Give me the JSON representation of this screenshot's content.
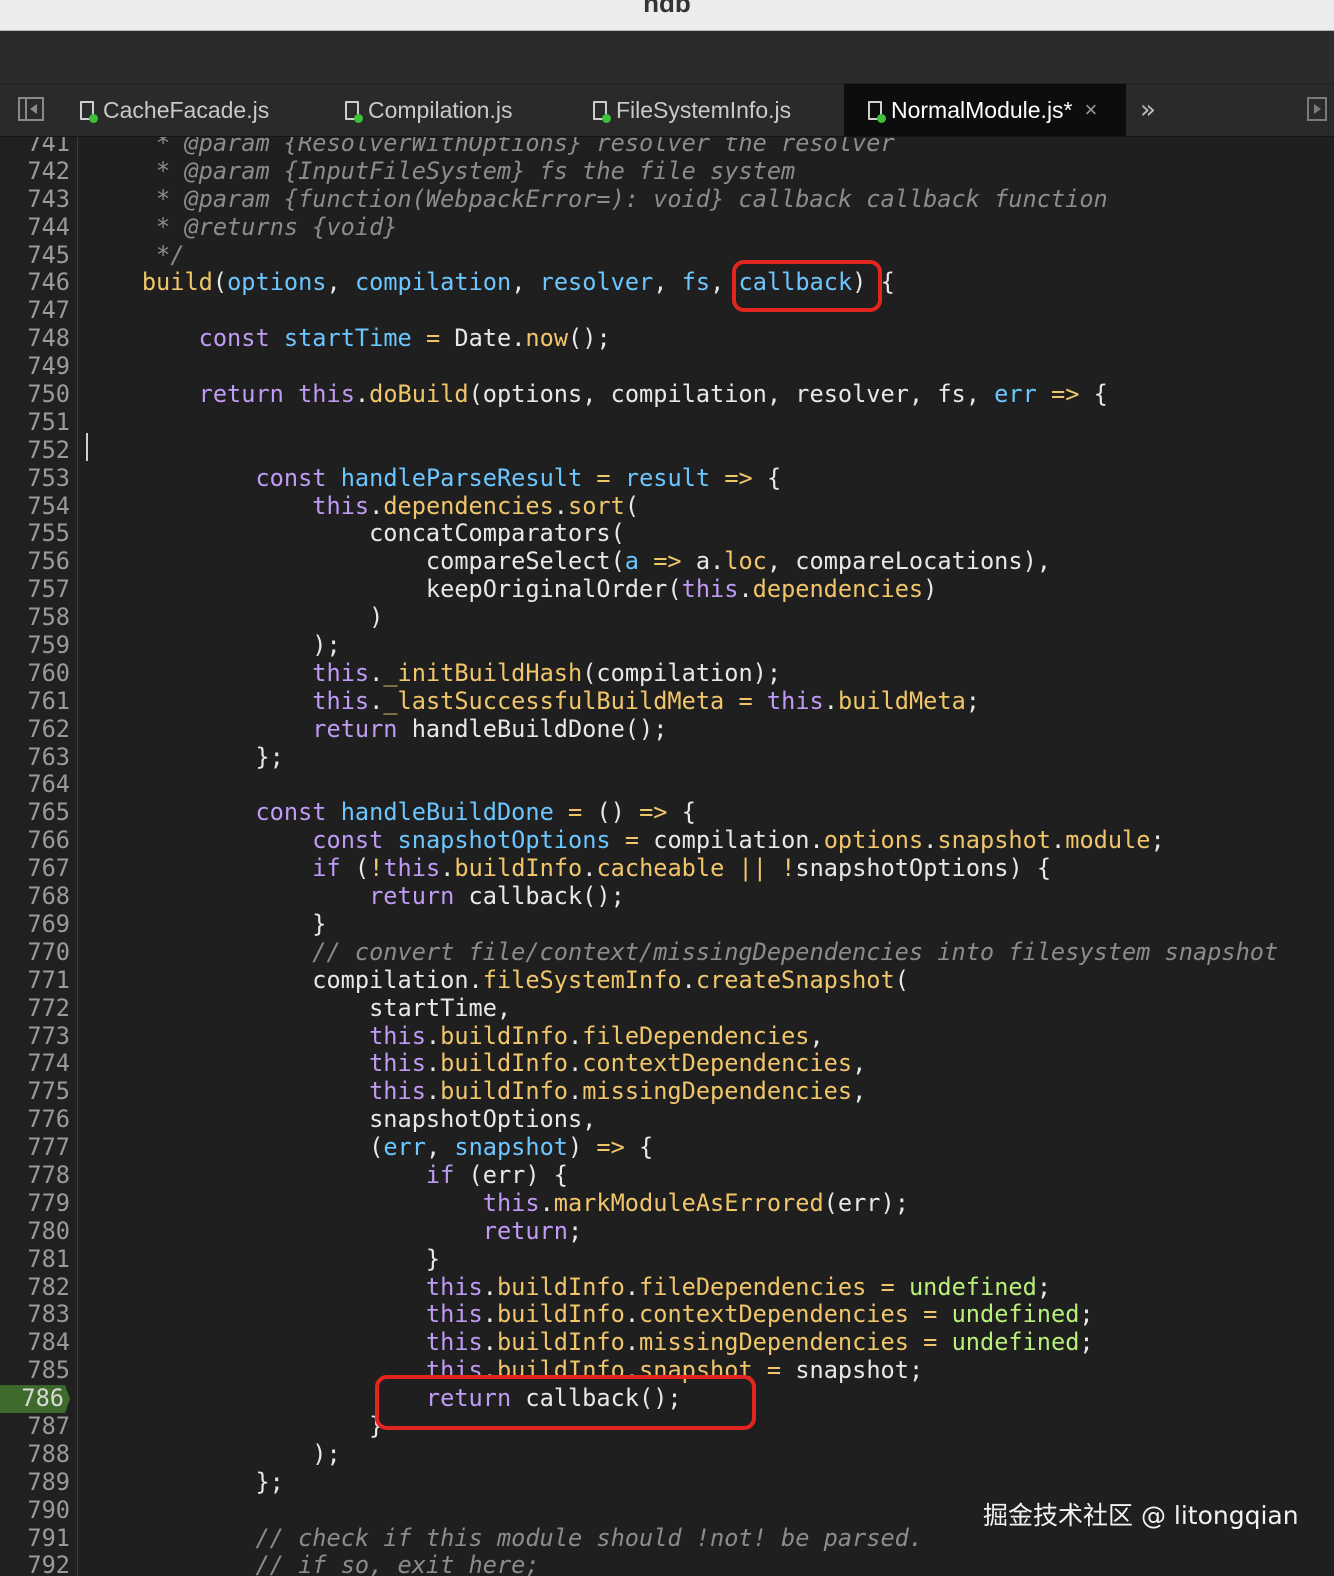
{
  "window": {
    "title": "ndb"
  },
  "tabs": [
    {
      "label": "CacheFacade.js",
      "active": false
    },
    {
      "label": "Compilation.js",
      "active": false
    },
    {
      "label": "FileSystemInfo.js",
      "active": false
    },
    {
      "label": "NormalModule.js*",
      "active": true
    }
  ],
  "tab_close_glyph": "×",
  "overflow_glyph": "»",
  "breakpoint_line": "786",
  "colors": {
    "comment": "#8c8c8c",
    "keyword": "#c09bf5",
    "identifier": "#6cc6ff",
    "function": "#f1c66a",
    "constant": "#b8f07a",
    "annotation": "#e3251f",
    "breakpoint": "#3e6b2b"
  },
  "code": [
    {
      "n": "741",
      "tokens": [
        [
          "cm",
          "     * @param {ResolverWithOptions} resolver the resolver"
        ]
      ]
    },
    {
      "n": "742",
      "tokens": [
        [
          "cm",
          "     * @param {InputFileSystem} fs the file system"
        ]
      ]
    },
    {
      "n": "743",
      "tokens": [
        [
          "cm",
          "     * @param {function(WebpackError=): void} callback callback function"
        ]
      ]
    },
    {
      "n": "744",
      "tokens": [
        [
          "cm",
          "     * @returns {void}"
        ]
      ]
    },
    {
      "n": "745",
      "tokens": [
        [
          "cm",
          "     */"
        ]
      ]
    },
    {
      "n": "746",
      "tokens": [
        [
          "pl",
          "    "
        ],
        [
          "fn",
          "build"
        ],
        [
          "pl",
          "("
        ],
        [
          "id",
          "options"
        ],
        [
          "pl",
          ", "
        ],
        [
          "id",
          "compilation"
        ],
        [
          "pl",
          ", "
        ],
        [
          "id",
          "resolver"
        ],
        [
          "pl",
          ", "
        ],
        [
          "id",
          "fs"
        ],
        [
          "pl",
          ", "
        ],
        [
          "id",
          "callback"
        ],
        [
          "pl",
          ") {"
        ]
      ]
    },
    {
      "n": "747",
      "tokens": []
    },
    {
      "n": "748",
      "tokens": [
        [
          "pl",
          "        "
        ],
        [
          "kw",
          "const"
        ],
        [
          "pl",
          " "
        ],
        [
          "id",
          "startTime"
        ],
        [
          "pl",
          " "
        ],
        [
          "fn",
          "="
        ],
        [
          "pl",
          " Date."
        ],
        [
          "fn",
          "now"
        ],
        [
          "pl",
          "();"
        ]
      ]
    },
    {
      "n": "749",
      "tokens": []
    },
    {
      "n": "750",
      "tokens": [
        [
          "pl",
          "        "
        ],
        [
          "kw",
          "return"
        ],
        [
          "pl",
          " "
        ],
        [
          "kw",
          "this"
        ],
        [
          "pl",
          "."
        ],
        [
          "fn",
          "doBuild"
        ],
        [
          "pl",
          "(options, compilation, resolver, fs, "
        ],
        [
          "id",
          "err"
        ],
        [
          "pl",
          " "
        ],
        [
          "fn",
          "=>"
        ],
        [
          "pl",
          " {"
        ]
      ]
    },
    {
      "n": "751",
      "tokens": []
    },
    {
      "n": "752",
      "tokens": []
    },
    {
      "n": "753",
      "tokens": [
        [
          "pl",
          "            "
        ],
        [
          "kw",
          "const"
        ],
        [
          "pl",
          " "
        ],
        [
          "id",
          "handleParseResult"
        ],
        [
          "pl",
          " "
        ],
        [
          "fn",
          "="
        ],
        [
          "pl",
          " "
        ],
        [
          "id",
          "result"
        ],
        [
          "pl",
          " "
        ],
        [
          "fn",
          "=>"
        ],
        [
          "pl",
          " {"
        ]
      ]
    },
    {
      "n": "754",
      "tokens": [
        [
          "pl",
          "                "
        ],
        [
          "kw",
          "this"
        ],
        [
          "pl",
          "."
        ],
        [
          "fn",
          "dependencies"
        ],
        [
          "pl",
          "."
        ],
        [
          "fn",
          "sort"
        ],
        [
          "pl",
          "("
        ]
      ]
    },
    {
      "n": "755",
      "tokens": [
        [
          "pl",
          "                    concatComparators("
        ]
      ]
    },
    {
      "n": "756",
      "tokens": [
        [
          "pl",
          "                        compareSelect("
        ],
        [
          "id",
          "a"
        ],
        [
          "pl",
          " "
        ],
        [
          "fn",
          "=>"
        ],
        [
          "pl",
          " a."
        ],
        [
          "fn",
          "loc"
        ],
        [
          "pl",
          ", compareLocations),"
        ]
      ]
    },
    {
      "n": "757",
      "tokens": [
        [
          "pl",
          "                        keepOriginalOrder("
        ],
        [
          "kw",
          "this"
        ],
        [
          "pl",
          "."
        ],
        [
          "fn",
          "dependencies"
        ],
        [
          "pl",
          ")"
        ]
      ]
    },
    {
      "n": "758",
      "tokens": [
        [
          "pl",
          "                    )"
        ]
      ]
    },
    {
      "n": "759",
      "tokens": [
        [
          "pl",
          "                );"
        ]
      ]
    },
    {
      "n": "760",
      "tokens": [
        [
          "pl",
          "                "
        ],
        [
          "kw",
          "this"
        ],
        [
          "pl",
          "."
        ],
        [
          "fn",
          "_initBuildHash"
        ],
        [
          "pl",
          "(compilation);"
        ]
      ]
    },
    {
      "n": "761",
      "tokens": [
        [
          "pl",
          "                "
        ],
        [
          "kw",
          "this"
        ],
        [
          "pl",
          "."
        ],
        [
          "fn",
          "_lastSuccessfulBuildMeta"
        ],
        [
          "pl",
          " "
        ],
        [
          "fn",
          "="
        ],
        [
          "pl",
          " "
        ],
        [
          "kw",
          "this"
        ],
        [
          "pl",
          "."
        ],
        [
          "fn",
          "buildMeta"
        ],
        [
          "pl",
          ";"
        ]
      ]
    },
    {
      "n": "762",
      "tokens": [
        [
          "pl",
          "                "
        ],
        [
          "kw",
          "return"
        ],
        [
          "pl",
          " handleBuildDone();"
        ]
      ]
    },
    {
      "n": "763",
      "tokens": [
        [
          "pl",
          "            };"
        ]
      ]
    },
    {
      "n": "764",
      "tokens": []
    },
    {
      "n": "765",
      "tokens": [
        [
          "pl",
          "            "
        ],
        [
          "kw",
          "const"
        ],
        [
          "pl",
          " "
        ],
        [
          "id",
          "handleBuildDone"
        ],
        [
          "pl",
          " "
        ],
        [
          "fn",
          "="
        ],
        [
          "pl",
          " () "
        ],
        [
          "fn",
          "=>"
        ],
        [
          "pl",
          " {"
        ]
      ]
    },
    {
      "n": "766",
      "tokens": [
        [
          "pl",
          "                "
        ],
        [
          "kw",
          "const"
        ],
        [
          "pl",
          " "
        ],
        [
          "id",
          "snapshotOptions"
        ],
        [
          "pl",
          " "
        ],
        [
          "fn",
          "="
        ],
        [
          "pl",
          " compilation."
        ],
        [
          "fn",
          "options"
        ],
        [
          "pl",
          "."
        ],
        [
          "fn",
          "snapshot"
        ],
        [
          "pl",
          "."
        ],
        [
          "fn",
          "module"
        ],
        [
          "pl",
          ";"
        ]
      ]
    },
    {
      "n": "767",
      "tokens": [
        [
          "pl",
          "                "
        ],
        [
          "kw",
          "if"
        ],
        [
          "pl",
          " ("
        ],
        [
          "fn",
          "!"
        ],
        [
          "kw",
          "this"
        ],
        [
          "pl",
          "."
        ],
        [
          "fn",
          "buildInfo"
        ],
        [
          "pl",
          "."
        ],
        [
          "fn",
          "cacheable"
        ],
        [
          "pl",
          " "
        ],
        [
          "fn",
          "||"
        ],
        [
          "pl",
          " "
        ],
        [
          "fn",
          "!"
        ],
        [
          "pl",
          "snapshotOptions) {"
        ]
      ]
    },
    {
      "n": "768",
      "tokens": [
        [
          "pl",
          "                    "
        ],
        [
          "kw",
          "return"
        ],
        [
          "pl",
          " callback();"
        ]
      ]
    },
    {
      "n": "769",
      "tokens": [
        [
          "pl",
          "                }"
        ]
      ]
    },
    {
      "n": "770",
      "tokens": [
        [
          "pl",
          "                "
        ],
        [
          "cm",
          "// convert file/context/missingDependencies into filesystem snapshot"
        ]
      ]
    },
    {
      "n": "771",
      "tokens": [
        [
          "pl",
          "                compilation."
        ],
        [
          "fn",
          "fileSystemInfo"
        ],
        [
          "pl",
          "."
        ],
        [
          "fn",
          "createSnapshot"
        ],
        [
          "pl",
          "("
        ]
      ]
    },
    {
      "n": "772",
      "tokens": [
        [
          "pl",
          "                    startTime,"
        ]
      ]
    },
    {
      "n": "773",
      "tokens": [
        [
          "pl",
          "                    "
        ],
        [
          "kw",
          "this"
        ],
        [
          "pl",
          "."
        ],
        [
          "fn",
          "buildInfo"
        ],
        [
          "pl",
          "."
        ],
        [
          "fn",
          "fileDependencies"
        ],
        [
          "pl",
          ","
        ]
      ]
    },
    {
      "n": "774",
      "tokens": [
        [
          "pl",
          "                    "
        ],
        [
          "kw",
          "this"
        ],
        [
          "pl",
          "."
        ],
        [
          "fn",
          "buildInfo"
        ],
        [
          "pl",
          "."
        ],
        [
          "fn",
          "contextDependencies"
        ],
        [
          "pl",
          ","
        ]
      ]
    },
    {
      "n": "775",
      "tokens": [
        [
          "pl",
          "                    "
        ],
        [
          "kw",
          "this"
        ],
        [
          "pl",
          "."
        ],
        [
          "fn",
          "buildInfo"
        ],
        [
          "pl",
          "."
        ],
        [
          "fn",
          "missingDependencies"
        ],
        [
          "pl",
          ","
        ]
      ]
    },
    {
      "n": "776",
      "tokens": [
        [
          "pl",
          "                    snapshotOptions,"
        ]
      ]
    },
    {
      "n": "777",
      "tokens": [
        [
          "pl",
          "                    ("
        ],
        [
          "id",
          "err"
        ],
        [
          "pl",
          ", "
        ],
        [
          "id",
          "snapshot"
        ],
        [
          "pl",
          ") "
        ],
        [
          "fn",
          "=>"
        ],
        [
          "pl",
          " {"
        ]
      ]
    },
    {
      "n": "778",
      "tokens": [
        [
          "pl",
          "                        "
        ],
        [
          "kw",
          "if"
        ],
        [
          "pl",
          " (err) {"
        ]
      ]
    },
    {
      "n": "779",
      "tokens": [
        [
          "pl",
          "                            "
        ],
        [
          "kw",
          "this"
        ],
        [
          "pl",
          "."
        ],
        [
          "fn",
          "markModuleAsErrored"
        ],
        [
          "pl",
          "(err);"
        ]
      ]
    },
    {
      "n": "780",
      "tokens": [
        [
          "pl",
          "                            "
        ],
        [
          "kw",
          "return"
        ],
        [
          "pl",
          ";"
        ]
      ]
    },
    {
      "n": "781",
      "tokens": [
        [
          "pl",
          "                        }"
        ]
      ]
    },
    {
      "n": "782",
      "tokens": [
        [
          "pl",
          "                        "
        ],
        [
          "kw",
          "this"
        ],
        [
          "pl",
          "."
        ],
        [
          "fn",
          "buildInfo"
        ],
        [
          "pl",
          "."
        ],
        [
          "fn",
          "fileDependencies"
        ],
        [
          "pl",
          " "
        ],
        [
          "fn",
          "="
        ],
        [
          "pl",
          " "
        ],
        [
          "ct",
          "undefined"
        ],
        [
          "pl",
          ";"
        ]
      ]
    },
    {
      "n": "783",
      "tokens": [
        [
          "pl",
          "                        "
        ],
        [
          "kw",
          "this"
        ],
        [
          "pl",
          "."
        ],
        [
          "fn",
          "buildInfo"
        ],
        [
          "pl",
          "."
        ],
        [
          "fn",
          "contextDependencies"
        ],
        [
          "pl",
          " "
        ],
        [
          "fn",
          "="
        ],
        [
          "pl",
          " "
        ],
        [
          "ct",
          "undefined"
        ],
        [
          "pl",
          ";"
        ]
      ]
    },
    {
      "n": "784",
      "tokens": [
        [
          "pl",
          "                        "
        ],
        [
          "kw",
          "this"
        ],
        [
          "pl",
          "."
        ],
        [
          "fn",
          "buildInfo"
        ],
        [
          "pl",
          "."
        ],
        [
          "fn",
          "missingDependencies"
        ],
        [
          "pl",
          " "
        ],
        [
          "fn",
          "="
        ],
        [
          "pl",
          " "
        ],
        [
          "ct",
          "undefined"
        ],
        [
          "pl",
          ";"
        ]
      ]
    },
    {
      "n": "785",
      "tokens": [
        [
          "pl",
          "                        "
        ],
        [
          "kw",
          "this"
        ],
        [
          "pl",
          "."
        ],
        [
          "fn",
          "buildInfo"
        ],
        [
          "pl",
          "."
        ],
        [
          "fn",
          "snapshot"
        ],
        [
          "pl",
          " "
        ],
        [
          "fn",
          "="
        ],
        [
          "pl",
          " snapshot;"
        ]
      ]
    },
    {
      "n": "786",
      "tokens": [
        [
          "pl",
          "                        "
        ],
        [
          "kw",
          "return"
        ],
        [
          "pl",
          " callback();"
        ]
      ]
    },
    {
      "n": "787",
      "tokens": [
        [
          "pl",
          "                    }"
        ]
      ]
    },
    {
      "n": "788",
      "tokens": [
        [
          "pl",
          "                );"
        ]
      ]
    },
    {
      "n": "789",
      "tokens": [
        [
          "pl",
          "            };"
        ]
      ]
    },
    {
      "n": "790",
      "tokens": []
    },
    {
      "n": "791",
      "tokens": [
        [
          "pl",
          "            "
        ],
        [
          "cm",
          "// check if this module should !not! be parsed."
        ]
      ]
    },
    {
      "n": "792",
      "tokens": [
        [
          "pl",
          "            "
        ],
        [
          "cm",
          "// if so, exit here;"
        ]
      ]
    }
  ],
  "watermark": "掘金技术社区 @ litongqian"
}
